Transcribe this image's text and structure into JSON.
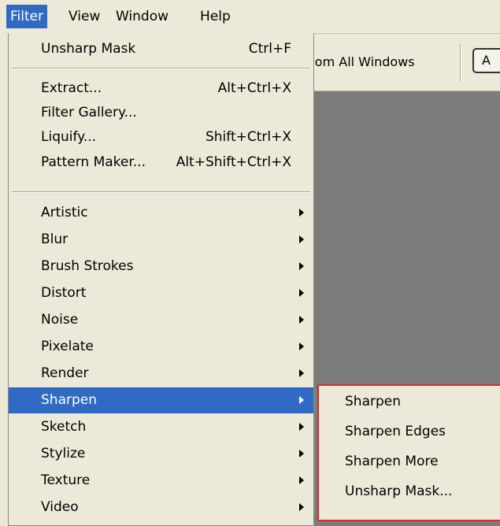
{
  "menubar": {
    "items": [
      {
        "label": "Filter",
        "active": true
      },
      {
        "label": "View"
      },
      {
        "label": "Window"
      },
      {
        "label": "Help"
      }
    ]
  },
  "options_bar": {
    "zoom_all_label": "oom All Windows",
    "actual_label": "A"
  },
  "filter_menu": {
    "unsharp_mask_label": "Unsharp Mask",
    "unsharp_mask_shortcut": "Ctrl+F",
    "extract_label": "Extract...",
    "extract_shortcut": "Alt+Ctrl+X",
    "filter_gallery_label": "Filter Gallery...",
    "liquify_label": "Liquify...",
    "liquify_shortcut": "Shift+Ctrl+X",
    "pattern_maker_label": "Pattern Maker...",
    "pattern_maker_shortcut": "Alt+Shift+Ctrl+X",
    "artistic_label": "Artistic",
    "blur_label": "Blur",
    "brush_strokes_label": "Brush Strokes",
    "distort_label": "Distort",
    "noise_label": "Noise",
    "pixelate_label": "Pixelate",
    "render_label": "Render",
    "sharpen_label": "Sharpen",
    "sketch_label": "Sketch",
    "stylize_label": "Stylize",
    "texture_label": "Texture",
    "video_label": "Video"
  },
  "sharpen_submenu": {
    "items": [
      "Sharpen",
      "Sharpen Edges",
      "Sharpen More",
      "Unsharp Mask..."
    ]
  },
  "colors": {
    "highlight": "#316ac5",
    "menu_bg": "#ece9d8",
    "submenu_border": "#d22c2c",
    "workspace": "#7c7c7c"
  }
}
